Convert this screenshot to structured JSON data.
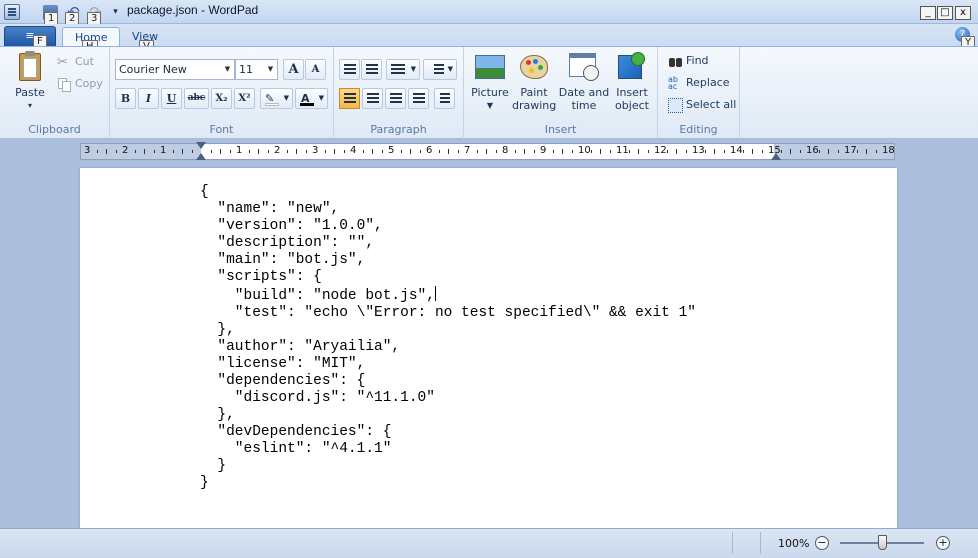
{
  "window": {
    "title": "package.json - WordPad",
    "minimize_glyph": "_",
    "maximize_glyph": "□",
    "close_glyph": "x"
  },
  "quick_access": {
    "key_tips": [
      "1",
      "2",
      "3"
    ],
    "undo_glyph": "↶",
    "redo_glyph": "↷",
    "more_glyph": "▾"
  },
  "ribbon_tabs": {
    "app_menu_glyph": "≡",
    "app_menu_key_tip": "F",
    "home_label": "Home",
    "home_key_tip": "H",
    "view_label": "View",
    "view_key_tip": "V",
    "help_glyph": "?",
    "help_key_tip": "Y"
  },
  "clipboard": {
    "group_label": "Clipboard",
    "paste_label": "Paste",
    "paste_arrow": "▾",
    "cut_label": "Cut",
    "copy_label": "Copy"
  },
  "font": {
    "group_label": "Font",
    "family_value": "Courier New",
    "size_value": "11",
    "grow_glyph": "A",
    "shrink_glyph": "A",
    "bold_glyph": "B",
    "italic_glyph": "I",
    "underline_glyph": "U",
    "strike_glyph": "abc",
    "subscript_glyph": "X₂",
    "superscript_glyph": "X²",
    "highlight_glyph": "✎",
    "color_glyph": "A"
  },
  "paragraph": {
    "group_label": "Paragraph"
  },
  "insert": {
    "group_label": "Insert",
    "picture_label": "Picture",
    "paint_label_1": "Paint",
    "paint_label_2": "drawing",
    "datetime_label_1": "Date and",
    "datetime_label_2": "time",
    "object_label_1": "Insert",
    "object_label_2": "object"
  },
  "editing": {
    "group_label": "Editing",
    "find_label": "Find",
    "replace_label": "Replace",
    "select_all_label": "Select all"
  },
  "ruler": {
    "numbers": [
      "3",
      "2",
      "1",
      "1",
      "2",
      "3",
      "4",
      "5",
      "6",
      "7",
      "8",
      "9",
      "10",
      "11",
      "12",
      "13",
      "14",
      "15",
      "16",
      "17",
      "18"
    ]
  },
  "document": {
    "lines": [
      "{",
      "  \"name\": \"new\",",
      "  \"version\": \"1.0.0\",",
      "  \"description\": \"\",",
      "  \"main\": \"bot.js\",",
      "  \"scripts\": {",
      "    \"build\": \"node bot.js\",",
      "    \"test\": \"echo \\\"Error: no test specified\\\" && exit 1\"",
      "  },",
      "  \"author\": \"Aryailia\",",
      "  \"license\": \"MIT\",",
      "  \"dependencies\": {",
      "    \"discord.js\": \"^11.1.0\"",
      "  },",
      "  \"devDependencies\": {",
      "    \"eslint\": \"^4.1.1\"",
      "  }",
      "}"
    ],
    "caret_line": 6
  },
  "status": {
    "zoom_label": "100%",
    "zoom_percent": 100,
    "zoom_out_glyph": "−",
    "zoom_in_glyph": "+"
  }
}
